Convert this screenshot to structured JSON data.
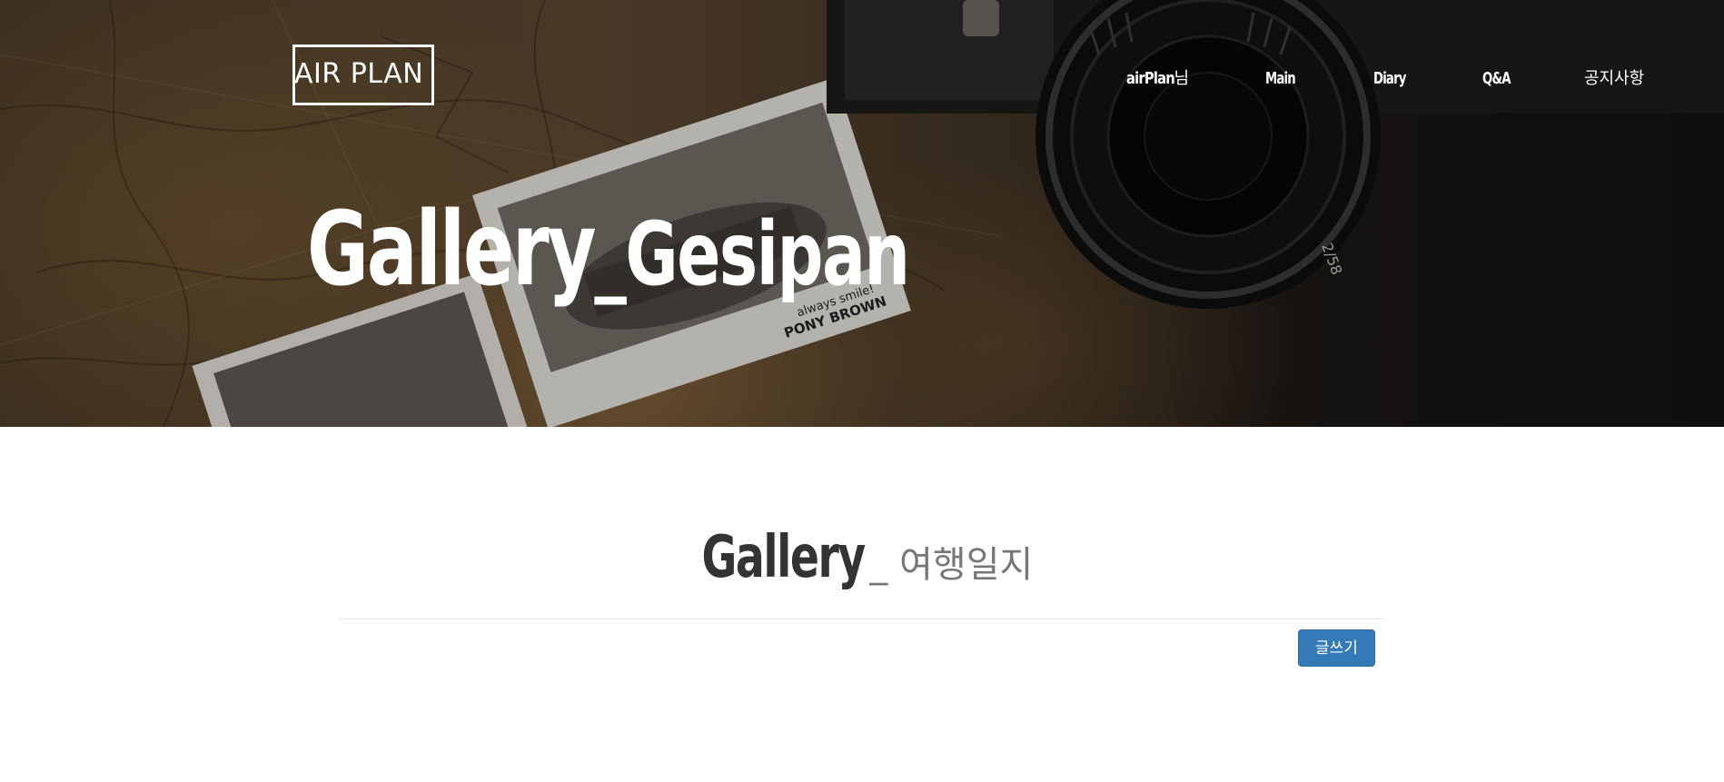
{
  "header": {
    "logo_text": "AIR PLAN",
    "nav": {
      "user_name": "airPlan",
      "user_suffix": "님",
      "main": "Main",
      "diary": "Diary",
      "qna": "Q&A",
      "notice": "공지사항"
    }
  },
  "hero": {
    "title_main": "Gallery",
    "title_sub": "_Gesipan",
    "photo_caption_line1": "always smile!",
    "photo_caption_line2": "PONY BROWN",
    "lens_text": "2/58"
  },
  "content": {
    "section_title": "Gallery",
    "section_subtitle": "_ 여행일지",
    "write_button_label": "글쓰기"
  },
  "colors": {
    "button_primary": "#337ab7",
    "title_dark": "#333333",
    "subtitle_gray": "#777777"
  }
}
